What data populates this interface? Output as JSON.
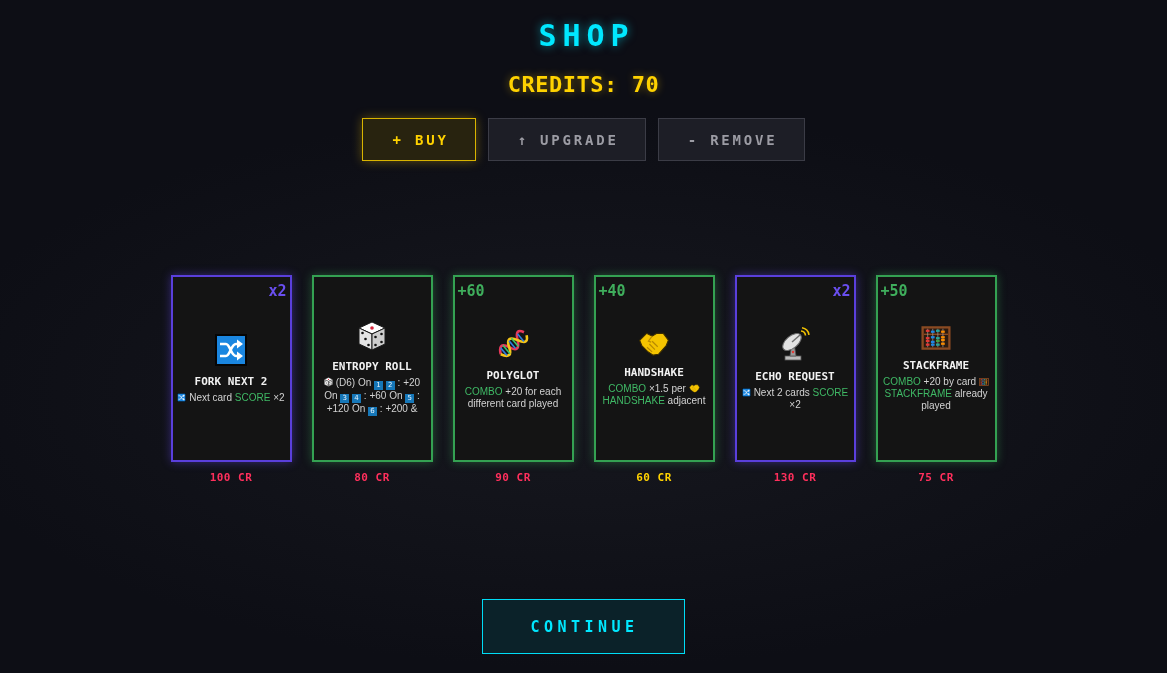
{
  "title": "SHOP",
  "credits": {
    "label": "CREDITS:",
    "value": "70"
  },
  "modes": [
    {
      "label": "+ BUY",
      "selected": true
    },
    {
      "label": "↑ UPGRADE",
      "selected": false
    },
    {
      "label": "- REMOVE",
      "selected": false
    }
  ],
  "cards": [
    {
      "kind": "mult",
      "bonus": "x2",
      "name": "FORK NEXT 2",
      "description": [
        [
          {
            "kind": "shuffle"
          },
          {
            "kind": "text",
            "text": "Next card"
          },
          {
            "kind": "keyword",
            "text": "SCORE"
          },
          {
            "kind": "text",
            "text": "×2"
          }
        ]
      ],
      "price": "100 CR",
      "affordable": false
    },
    {
      "kind": "add",
      "name": "ENTROPY ROLL",
      "description": [
        [
          {
            "kind": "dice"
          },
          {
            "kind": "text",
            "text": "(D6) On"
          },
          {
            "kind": "keycap",
            "text": "1"
          },
          {
            "kind": "keycap",
            "text": "2"
          },
          {
            "kind": "text",
            "text": ": +20"
          }
        ],
        [
          {
            "kind": "text",
            "text": "On"
          },
          {
            "kind": "keycap",
            "text": "3"
          },
          {
            "kind": "keycap",
            "text": "4"
          },
          {
            "kind": "text",
            "text": ": +60 On"
          },
          {
            "kind": "keycap",
            "text": "5"
          },
          {
            "kind": "text",
            "text": ":"
          }
        ],
        [
          {
            "kind": "text",
            "text": "+120 On"
          },
          {
            "kind": "keycap",
            "text": "6"
          },
          {
            "kind": "text",
            "text": ": +200 &"
          }
        ]
      ],
      "price": "80 CR",
      "affordable": false
    },
    {
      "kind": "add",
      "bonus": "+60",
      "name": "POLYGLOT",
      "description": [
        [
          {
            "kind": "keyword",
            "text": "COMBO"
          },
          {
            "kind": "text",
            "text": "+20 for each"
          }
        ],
        [
          {
            "kind": "text",
            "text": "different card played"
          }
        ]
      ],
      "price": "90 CR",
      "affordable": false
    },
    {
      "kind": "add",
      "bonus": "+40",
      "name": "HANDSHAKE",
      "description": [
        [
          {
            "kind": "keyword",
            "text": "COMBO"
          },
          {
            "kind": "text",
            "text": "×1.5 per"
          },
          {
            "kind": "handshake"
          }
        ],
        [
          {
            "kind": "keyword",
            "text": "HANDSHAKE"
          },
          {
            "kind": "text",
            "text": "adjacent"
          }
        ]
      ],
      "price": "60 CR",
      "affordable": true
    },
    {
      "kind": "mult",
      "bonus": "x2",
      "name": "ECHO REQUEST",
      "description": [
        [
          {
            "kind": "shuffle"
          },
          {
            "kind": "text",
            "text": "Next 2 cards"
          },
          {
            "kind": "keyword",
            "text": "SCORE"
          }
        ],
        [
          {
            "kind": "text",
            "text": "×2"
          }
        ]
      ],
      "price": "130 CR",
      "affordable": false
    },
    {
      "kind": "add",
      "bonus": "+50",
      "name": "STACKFRAME",
      "description": [
        [
          {
            "kind": "keyword",
            "text": "COMBO"
          },
          {
            "kind": "text",
            "text": "+20 by card"
          },
          {
            "kind": "abacus"
          }
        ],
        [
          {
            "kind": "keyword",
            "text": "STACKFRAME"
          },
          {
            "kind": "text",
            "text": "already"
          }
        ],
        [
          {
            "kind": "text",
            "text": "played"
          }
        ]
      ],
      "price": "75 CR",
      "affordable": false
    }
  ],
  "continue": {
    "label": "CONTINUE"
  }
}
